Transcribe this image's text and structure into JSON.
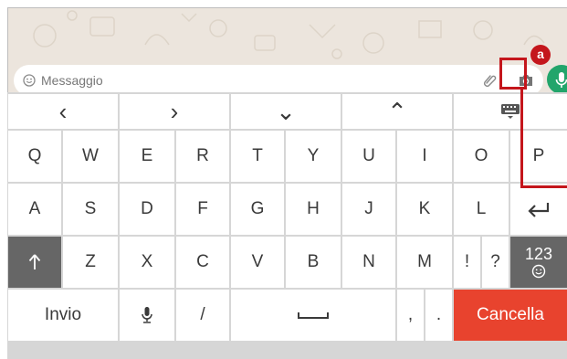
{
  "composer": {
    "placeholder": "Messaggio",
    "emoji_icon": "smiley-icon",
    "attach_icon": "paperclip-icon",
    "camera_icon": "camera-icon",
    "mic_icon": "microphone-icon"
  },
  "highlight": {
    "badge": "a"
  },
  "keyboard": {
    "nav_row": [
      "‹",
      "›",
      "⌄",
      "⌃"
    ],
    "row_qwerty": [
      "Q",
      "W",
      "E",
      "R",
      "T",
      "Y",
      "U",
      "I",
      "O",
      "P"
    ],
    "row_asdf": [
      "A",
      "S",
      "D",
      "F",
      "G",
      "H",
      "J",
      "K",
      "L"
    ],
    "row_zxcv": [
      "Z",
      "X",
      "C",
      "V",
      "B",
      "N",
      "M"
    ],
    "excl": "!",
    "question": "?",
    "num_label": "123",
    "invio": "Invio",
    "slash": "/",
    "comma": ",",
    "period": ".",
    "cancella": "Cancella"
  },
  "colors": {
    "chat_background": "#ece5dd",
    "mic_green": "#22a56b",
    "highlight_red": "#c4161c",
    "cancella_red": "#e8432e",
    "shift_gray": "#666666"
  }
}
